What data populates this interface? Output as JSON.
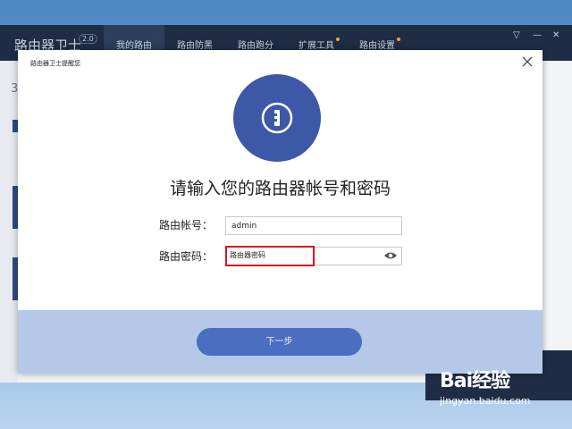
{
  "background_app": {
    "title": "路由器卫士",
    "version": "2.0",
    "tabs": [
      {
        "label": "我的路由",
        "active": true,
        "dot": false
      },
      {
        "label": "路由防黑",
        "active": false,
        "dot": false
      },
      {
        "label": "路由跑分",
        "active": false,
        "dot": false
      },
      {
        "label": "扩展工具",
        "active": false,
        "dot": true
      },
      {
        "label": "路由设置",
        "active": false,
        "dot": true
      }
    ],
    "window_controls": {
      "dropdown": "▽",
      "minimize": "—",
      "close": "✕"
    },
    "side_number": "3"
  },
  "dialog": {
    "title": "路由器卫士提醒您",
    "heading": "请输入您的路由器帐号和密码",
    "account_label": "路由帐号：",
    "account_value": "admin",
    "password_label": "路由密码：",
    "password_value": "路由器密码",
    "next_button": "下一步",
    "lock_icon": "key-lock-icon",
    "colors": {
      "accent": "#3d58a6",
      "footer": "#b6c8e8",
      "button": "#4a6fc1",
      "highlight": "#d9141c"
    }
  },
  "watermark": {
    "logo": "Bai经验",
    "url": "jingyan.baidu.com"
  }
}
